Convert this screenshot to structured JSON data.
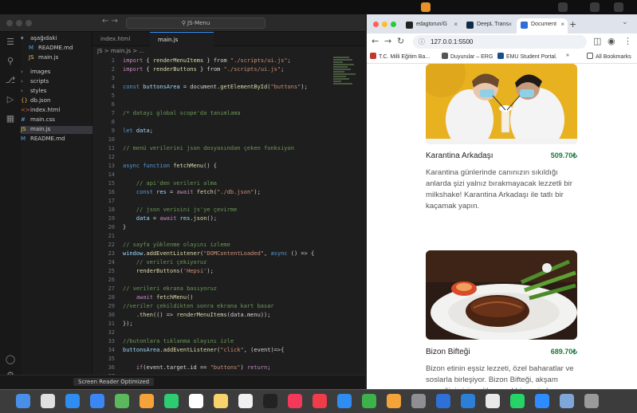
{
  "menubar": {
    "right_icons": [
      "microphone-icon",
      "wifi-icon",
      "battery-icon",
      "control-center-icon"
    ]
  },
  "vscode": {
    "search_text": "JS-Menu",
    "explorer": [
      {
        "label": "aşağıdaki",
        "icon": "folder-icon"
      },
      {
        "label": "README.md",
        "icon": "markdown-icon"
      },
      {
        "label": "main.js",
        "icon": "js-icon"
      },
      {
        "label": "images",
        "icon": "folder-icon"
      },
      {
        "label": "scripts",
        "icon": "folder-icon"
      },
      {
        "label": "styles",
        "icon": "folder-icon"
      },
      {
        "label": "db.json",
        "icon": "json-icon"
      },
      {
        "label": "index.html",
        "icon": "html-icon"
      },
      {
        "label": "main.css",
        "icon": "css-icon"
      },
      {
        "label": "main.js",
        "icon": "js-icon"
      },
      {
        "label": "README.md",
        "icon": "markdown-icon"
      }
    ],
    "tabs": [
      {
        "label": "index.html"
      },
      {
        "label": "main.js"
      }
    ],
    "breadcrumb": "JS > main.js > ...",
    "lines": [
      {
        "n": "1",
        "segs": [
          [
            "kw",
            "import "
          ],
          [
            "pl",
            "{ "
          ],
          [
            "fn",
            "renderMenuItems"
          ],
          [
            "pl",
            " } from "
          ],
          [
            "str",
            "\"./scripts/ui.js\""
          ],
          [
            "pl",
            ";"
          ]
        ]
      },
      {
        "n": "2",
        "segs": [
          [
            "kw",
            "import "
          ],
          [
            "pl",
            "{ "
          ],
          [
            "fn",
            "renderButtons"
          ],
          [
            "pl",
            " } from "
          ],
          [
            "str",
            "\"./scripts/ui.js\""
          ],
          [
            "pl",
            ";"
          ]
        ]
      },
      {
        "n": "3",
        "segs": []
      },
      {
        "n": "4",
        "segs": [
          [
            "bl",
            "const "
          ],
          [
            "var",
            "buttonsArea"
          ],
          [
            "pl",
            " = document."
          ],
          [
            "fn",
            "getElementById"
          ],
          [
            "pl",
            "("
          ],
          [
            "str",
            "\"buttons\""
          ],
          [
            "pl",
            ");"
          ]
        ]
      },
      {
        "n": "5",
        "segs": []
      },
      {
        "n": "6",
        "segs": []
      },
      {
        "n": "7",
        "segs": [
          [
            "cm",
            "/* datayı global scope'da tanımlama"
          ]
        ]
      },
      {
        "n": "8",
        "segs": []
      },
      {
        "n": "9",
        "segs": [
          [
            "bl",
            "let "
          ],
          [
            "var",
            "data"
          ],
          [
            "pl",
            ";"
          ]
        ]
      },
      {
        "n": "10",
        "segs": []
      },
      {
        "n": "11",
        "segs": [
          [
            "cm",
            "// menü verilerini json dosyasından çeken fonksiyon"
          ]
        ]
      },
      {
        "n": "12",
        "segs": []
      },
      {
        "n": "13",
        "segs": [
          [
            "bl",
            "async function "
          ],
          [
            "fn",
            "fetchMenu"
          ],
          [
            "pl",
            "() {"
          ]
        ]
      },
      {
        "n": "14",
        "segs": []
      },
      {
        "n": "15",
        "segs": [
          [
            "cm",
            "    // api'den verileri alma"
          ]
        ]
      },
      {
        "n": "16",
        "segs": [
          [
            "bl",
            "    const "
          ],
          [
            "var",
            "res"
          ],
          [
            "pl",
            " = "
          ],
          [
            "kw",
            "await "
          ],
          [
            "fn",
            "fetch"
          ],
          [
            "pl",
            "("
          ],
          [
            "str",
            "\"./db.json\""
          ],
          [
            "pl",
            ");"
          ]
        ]
      },
      {
        "n": "17",
        "segs": []
      },
      {
        "n": "18",
        "segs": [
          [
            "cm",
            "    // json verisini js'ye çevirme"
          ]
        ]
      },
      {
        "n": "19",
        "segs": [
          [
            "var",
            "    data"
          ],
          [
            "pl",
            " = "
          ],
          [
            "kw",
            "await "
          ],
          [
            "var",
            "res"
          ],
          [
            "pl",
            "."
          ],
          [
            "fn",
            "json"
          ],
          [
            "pl",
            "();"
          ]
        ]
      },
      {
        "n": "20",
        "segs": [
          [
            "pl",
            "}"
          ]
        ]
      },
      {
        "n": "21",
        "segs": []
      },
      {
        "n": "22",
        "segs": [
          [
            "cm",
            "// sayfa yüklenme olayını izleme"
          ]
        ]
      },
      {
        "n": "23",
        "segs": [
          [
            "var",
            "window"
          ],
          [
            "pl",
            "."
          ],
          [
            "fn",
            "addEventListener"
          ],
          [
            "pl",
            "("
          ],
          [
            "str",
            "\"DOMContentLoaded\""
          ],
          [
            "pl",
            ", "
          ],
          [
            "bl",
            "async"
          ],
          [
            "pl",
            " () => {"
          ]
        ]
      },
      {
        "n": "24",
        "segs": [
          [
            "cm",
            "    // verileri çekiyoruz"
          ]
        ]
      },
      {
        "n": "25",
        "segs": [
          [
            "fn",
            "    renderButtons"
          ],
          [
            "pl",
            "("
          ],
          [
            "str",
            "'Hepsi'"
          ],
          [
            "pl",
            ");"
          ]
        ]
      },
      {
        "n": "26",
        "segs": []
      },
      {
        "n": "27",
        "segs": [
          [
            "cm",
            "// verileri ekrana basıyoruz"
          ]
        ]
      },
      {
        "n": "28",
        "segs": [
          [
            "kw",
            "    await "
          ],
          [
            "fn",
            "fetchMenu"
          ],
          [
            "pl",
            "()"
          ]
        ]
      },
      {
        "n": "29",
        "segs": [
          [
            "cm",
            "//veriler çekildikten sonra ekrana kart basar"
          ]
        ]
      },
      {
        "n": "30",
        "segs": [
          [
            "pl",
            "    ."
          ],
          [
            "fn",
            "then"
          ],
          [
            "pl",
            "(() => "
          ],
          [
            "fn",
            "renderMenuItems"
          ],
          [
            "pl",
            "(data.menu));"
          ]
        ]
      },
      {
        "n": "31",
        "segs": [
          [
            "pl",
            "});"
          ]
        ]
      },
      {
        "n": "32",
        "segs": []
      },
      {
        "n": "33",
        "segs": [
          [
            "cm",
            "//butonlara tıklanma olayını izle"
          ]
        ]
      },
      {
        "n": "34",
        "segs": [
          [
            "var",
            "buttonsArea"
          ],
          [
            "pl",
            "."
          ],
          [
            "fn",
            "addEventListener"
          ],
          [
            "pl",
            "("
          ],
          [
            "str",
            "\"click\""
          ],
          [
            "pl",
            ", (event)=>{"
          ]
        ]
      },
      {
        "n": "35",
        "segs": []
      },
      {
        "n": "36",
        "segs": [
          [
            "kw",
            "    if"
          ],
          [
            "pl",
            "(event.target.id == "
          ],
          [
            "str",
            "\"buttons\""
          ],
          [
            "pl",
            ") "
          ],
          [
            "kw",
            "return"
          ],
          [
            "pl",
            ";"
          ]
        ]
      },
      {
        "n": "37",
        "segs": []
      }
    ],
    "status_readout": "Screen Reader Optimized"
  },
  "chrome": {
    "tabs": [
      {
        "label": "edagtorun/G",
        "color": "#222222"
      },
      {
        "label": "DeepL Trans",
        "color": "#0f2b46"
      },
      {
        "label": "Document",
        "color": "#2e6fd8"
      }
    ],
    "url": "127.0.0.1:5500",
    "bookmarks": [
      {
        "label": "T.C. Milli Eğitim Ba...",
        "color": "#c0392b"
      },
      {
        "label": "Duyurular – ERG",
        "color": "#555555"
      },
      {
        "label": "EMU Student Portal.",
        "color": "#1a4d8f"
      }
    ],
    "all_bookmarks": "All Bookmarks"
  },
  "cards": [
    {
      "title": "Karantina Arkadaşı",
      "price": "509.70₺",
      "desc": "Karantina günlerinde canınızın sıkıldığı anlarda şizi yalnız bırakmayacak lezzetli bir milkshake! Karantina Arkadaşı ile tatlı bir kaçamak yapın."
    },
    {
      "title": "Bizon Bifteği",
      "price": "689.70₺",
      "desc": "Bizon etinin eşsiz lezzeti, özel baharatlar ve soslarla birleşiyor. Bizon Bifteği, akşam yemeğiniz için mükemmel bir seçim!"
    }
  ],
  "dock_apps": [
    "finder-icon",
    "launchpad-icon",
    "safari-icon",
    "mail-icon",
    "maps-icon",
    "photos-icon",
    "facetime-icon",
    "calendar-icon",
    "notes-icon",
    "reminders-icon",
    "appletv-icon",
    "music-icon",
    "news-icon",
    "appstore-icon",
    "numbers-icon",
    "pages-icon",
    "settings-icon",
    "xcode-icon",
    "vscode-icon",
    "chrome-icon",
    "whatsapp-icon",
    "zoom-icon",
    "preview-icon",
    "trash-icon"
  ]
}
